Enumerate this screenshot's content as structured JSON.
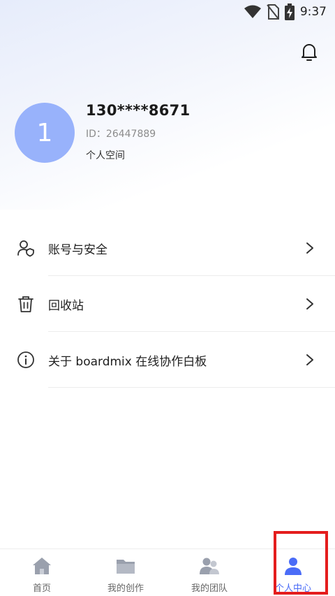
{
  "status_bar": {
    "time": "9:37"
  },
  "profile": {
    "avatar_initial": "1",
    "name": "130****8671",
    "id_text": "ID：26447889",
    "space": "个人空间"
  },
  "menu": [
    {
      "label": "账号与安全",
      "icon": "account-security-icon"
    },
    {
      "label": "回收站",
      "icon": "trash-icon"
    },
    {
      "label": "关于 boardmix 在线协作白板",
      "icon": "info-icon"
    }
  ],
  "tabs": [
    {
      "label": "首页",
      "icon": "home-icon",
      "active": false
    },
    {
      "label": "我的创作",
      "icon": "folder-icon",
      "active": false
    },
    {
      "label": "我的团队",
      "icon": "team-icon",
      "active": false
    },
    {
      "label": "个人中心",
      "icon": "person-icon",
      "active": true
    }
  ],
  "colors": {
    "accent": "#4a6cf7",
    "avatar": "#98b2fb",
    "inactive_icon": "#9aa0ad",
    "highlight": "#e41d1d"
  }
}
